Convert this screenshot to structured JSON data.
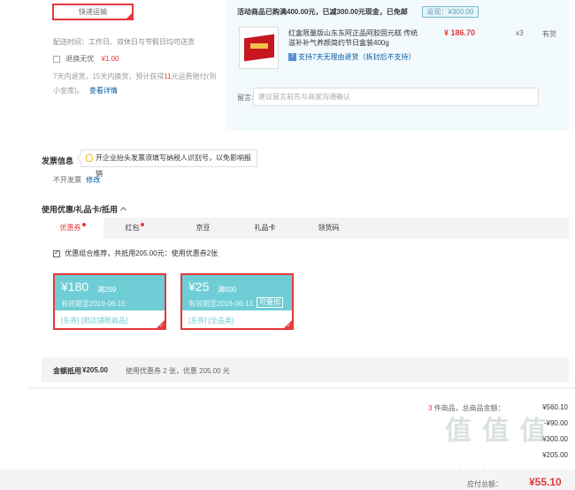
{
  "shipping": {
    "method_label": "快递运输",
    "time_text": "配送时间：工作日、双休日与节假日均可送货",
    "insurance_label": "退换无忧",
    "insurance_price": "¥1.00",
    "insurance_note_pre": "7天内退货，15天内换货，预计获得",
    "insurance_note_num": "11",
    "insurance_note_post": "元运费赔付(到小金库)。",
    "insurance_link": "查看详情"
  },
  "promo": {
    "text": "活动商品已购满400.00元，已减300.00元现金，已免邮",
    "saved_tag": "返现：¥300.00"
  },
  "product": {
    "name": "红盒限量版山东东阿正品阿胶固元糕 传统滋补补气养颜简约节日盒装400g",
    "price": "¥ 186.70",
    "qty": "x3",
    "stock": "有货",
    "return_policy": "支持7天无理由退货（拆封后不支持）"
  },
  "message": {
    "label": "留言:",
    "placeholder": "建议留言前先与商家沟通确认"
  },
  "invoice": {
    "title": "发票信息",
    "tip": "开企业抬头发票须填写纳税人识别号，以免影响报销",
    "value": "不开发票",
    "edit_link": "修改"
  },
  "coupons": {
    "section_title": "使用优惠/礼品卡/抵用",
    "tabs": [
      {
        "label": "优惠券"
      },
      {
        "label": "红包"
      },
      {
        "label": "京豆"
      },
      {
        "label": "礼品卡"
      },
      {
        "label": "领货码"
      }
    ],
    "combo_text": "优惠组合推荐，共抵用205.00元：使用优惠券2张",
    "items": [
      {
        "amount": "¥180",
        "condition": "满299",
        "expiry": "有效期至2019-06-15",
        "stackable": "",
        "scope": "[东券]  [限店铺限商品]"
      },
      {
        "amount": "¥25",
        "condition": "满500",
        "expiry": "有效期至2019-06-13",
        "stackable": "可叠加",
        "scope": "[东券]  [全品类]"
      }
    ],
    "deduct_label": "金额抵用",
    "deduct_amount": "¥205.00",
    "deduct_desc": "使用优惠券 2 张，优惠 205.00 元"
  },
  "summary": {
    "count_num": "3",
    "count_text": "件商品，总商品金额：",
    "total_goods": "¥560.10",
    "row2_val": "-¥90.00",
    "row3_val": "¥300.00",
    "row4_val": "¥205.00",
    "payable_label": "应付总额：",
    "payable": "¥55.10"
  },
  "watermark": {
    "big": "值 值 值",
    "small": "zhizhizhi.com"
  }
}
